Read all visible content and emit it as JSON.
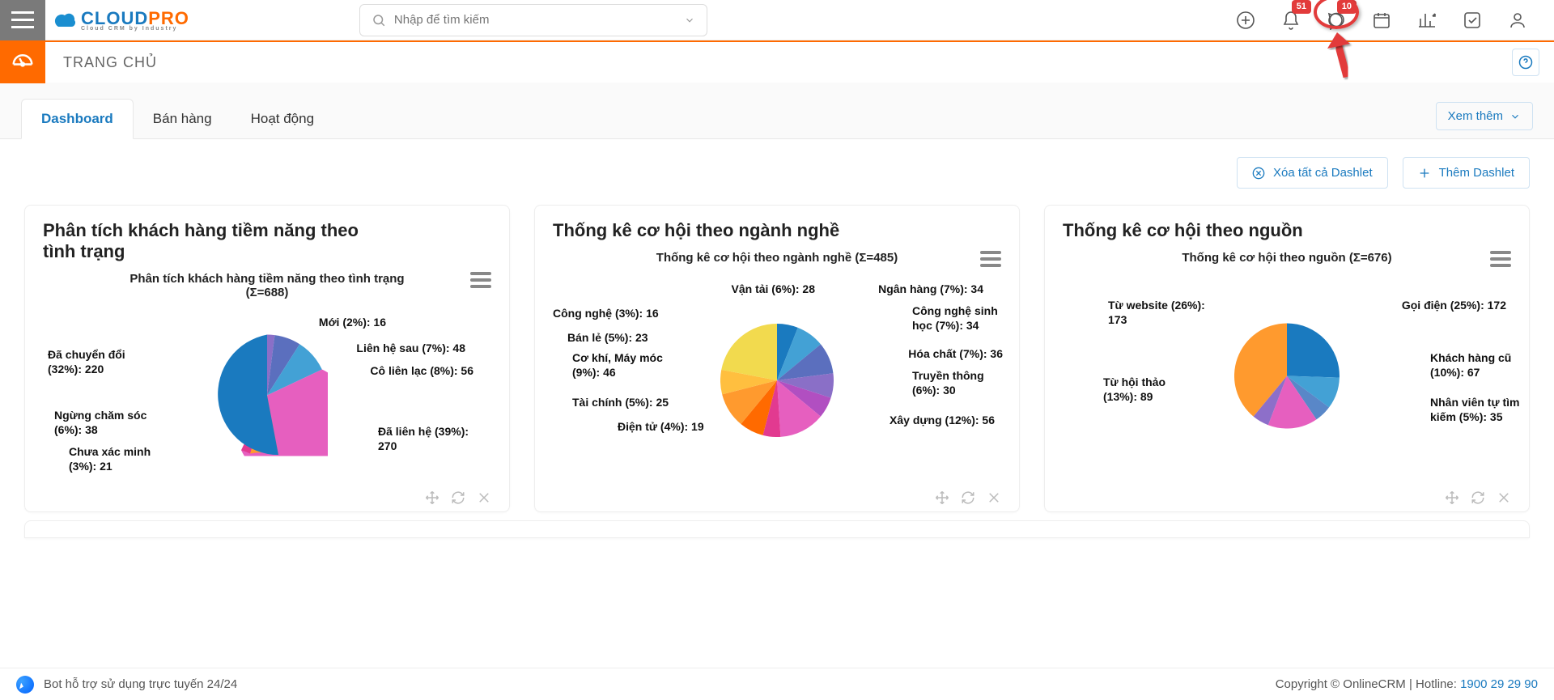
{
  "logo": {
    "main": "CLOUD",
    "accent": "PRO",
    "tagline": "Cloud CRM by Industry"
  },
  "search": {
    "placeholder": "Nhập để tìm kiếm"
  },
  "topbar": {
    "notif_count": "51",
    "chat_count": "10"
  },
  "subbar": {
    "title": "TRANG CHỦ"
  },
  "tabs": {
    "dashboard": "Dashboard",
    "sales": "Bán hàng",
    "activity": "Hoạt động",
    "more": "Xem thêm"
  },
  "actions": {
    "clear": "Xóa tất cả Dashlet",
    "add": "Thêm Dashlet"
  },
  "dashlets": [
    {
      "title": "Phân tích khách hàng tiềm năng theo tình trạng",
      "chart_title": "Phân tích khách hàng tiềm năng theo tình trạng (Σ=688)"
    },
    {
      "title": "Thống kê cơ hội theo ngành nghề",
      "chart_title": "Thống kê cơ hội theo ngành nghề (Σ=485)"
    },
    {
      "title": "Thống kê cơ hội theo nguồn",
      "chart_title": "Thống kê cơ hội theo nguồn (Σ=676)"
    }
  ],
  "chart_data": [
    {
      "type": "pie",
      "title": "Phân tích khách hàng tiềm năng theo tình trạng (Σ=688)",
      "total": 688,
      "series": [
        {
          "name": "Mới",
          "pct": 2,
          "value": 16,
          "label": "Mới (2%): 16"
        },
        {
          "name": "Liên hệ sau",
          "pct": 7,
          "value": 48,
          "label": "Liên hệ sau (7%): 48"
        },
        {
          "name": "Cô liên lạc",
          "pct": 8,
          "value": 56,
          "label": "Cô liên lạc (8%): 56"
        },
        {
          "name": "Đã liên hệ",
          "pct": 39,
          "value": 270,
          "label": "Đã liên hệ (39%): 270"
        },
        {
          "name": "Chưa xác minh",
          "pct": 3,
          "value": 21,
          "label": "Chưa xác minh (3%): 21"
        },
        {
          "name": "Ngừng chăm sóc",
          "pct": 6,
          "value": 38,
          "label": "Ngừng chăm sóc (6%): 38"
        },
        {
          "name": "Đã chuyển đổi",
          "pct": 32,
          "value": 220,
          "label": "Đã chuyển đổi (32%): 220"
        }
      ]
    },
    {
      "type": "pie",
      "title": "Thống kê cơ hội theo ngành nghề (Σ=485)",
      "total": 485,
      "series": [
        {
          "name": "Vận tải",
          "pct": 6,
          "value": 28,
          "label": "Vận tải (6%): 28"
        },
        {
          "name": "Ngân hàng",
          "pct": 7,
          "value": 34,
          "label": "Ngân hàng (7%): 34"
        },
        {
          "name": "Công nghệ sinh học",
          "pct": 7,
          "value": 34,
          "label": "Công nghệ sinh học (7%): 34"
        },
        {
          "name": "Hóa chất",
          "pct": 7,
          "value": 36,
          "label": "Hóa chất (7%): 36"
        },
        {
          "name": "Truyền thông",
          "pct": 6,
          "value": 30,
          "label": "Truyền thông (6%): 30"
        },
        {
          "name": "Xây dựng",
          "pct": 12,
          "value": 56,
          "label": "Xây dựng (12%): 56"
        },
        {
          "name": "Điện tử",
          "pct": 4,
          "value": 19,
          "label": "Điện tử (4%): 19"
        },
        {
          "name": "Tài chính",
          "pct": 5,
          "value": 25,
          "label": "Tài chính (5%): 25"
        },
        {
          "name": "Cơ khí, Máy móc",
          "pct": 9,
          "value": 46,
          "label": "Cơ khí, Máy móc (9%): 46"
        },
        {
          "name": "Bán lẻ",
          "pct": 5,
          "value": 23,
          "label": "Bán lẻ (5%): 23"
        },
        {
          "name": "Công nghệ",
          "pct": 3,
          "value": 16,
          "label": "Công nghệ (3%): 16"
        }
      ]
    },
    {
      "type": "pie",
      "title": "Thống kê cơ hội theo nguồn (Σ=676)",
      "total": 676,
      "series": [
        {
          "name": "Gọi điện",
          "pct": 25,
          "value": 172,
          "label": "Gọi điện (25%): 172"
        },
        {
          "name": "Khách hàng cũ",
          "pct": 10,
          "value": 67,
          "label": "Khách hàng cũ (10%): 67"
        },
        {
          "name": "Nhân viên tự tìm kiếm",
          "pct": 5,
          "value": 35,
          "label": "Nhân viên tự tìm kiếm (5%): 35"
        },
        {
          "name": "Từ hội thảo",
          "pct": 13,
          "value": 89,
          "label": "Từ hội thảo (13%): 89"
        },
        {
          "name": "Từ website",
          "pct": 26,
          "value": 173,
          "label": "Từ website (26%): 173"
        }
      ]
    }
  ],
  "footer": {
    "bot": "Bot hỗ trợ sử dụng trực tuyến 24/24",
    "copy": "Copyright © OnlineCRM",
    "hotline_label": "Hotline:",
    "hotline": "1900 29 29 90"
  }
}
